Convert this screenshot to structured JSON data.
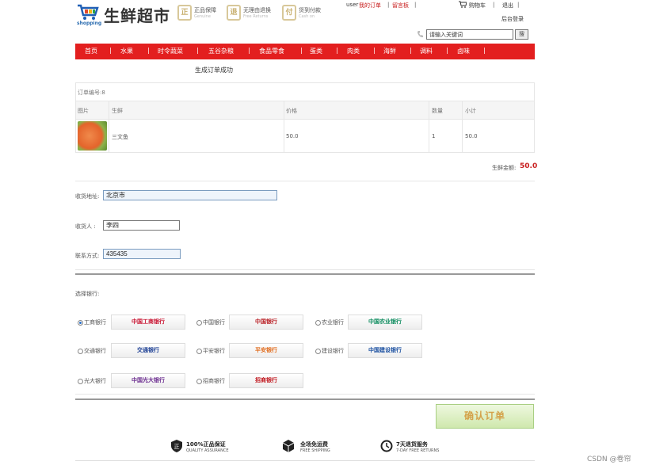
{
  "header": {
    "logo_sub": "shopping",
    "logo_title": "生鲜超市",
    "badges": [
      {
        "icon": "正",
        "title": "正品保障",
        "sub": "Genuine"
      },
      {
        "icon": "退",
        "title": "无理由退换",
        "sub": "Free Returns"
      },
      {
        "icon": "付",
        "title": "货到付款",
        "sub": "Cash on"
      }
    ],
    "user_label": "user",
    "my_orders": "我的订单",
    "message_board": "留言板",
    "cart": "购物车",
    "logout": "退出",
    "admin": "后台登录",
    "search_placeholder": "请输入关键词",
    "search_button": "搜"
  },
  "nav": [
    "首页",
    "水果",
    "时令蔬菜",
    "五谷杂粮",
    "食品零食",
    "蛋类",
    "肉类",
    "海鲜",
    "调料",
    "卤味"
  ],
  "message": "生成订单成功",
  "order": {
    "number_label": "订单编号:8",
    "columns": [
      "图片",
      "生鲜",
      "价格",
      "数量",
      "小计"
    ],
    "rows": [
      {
        "name": "三文鱼",
        "price": "50.0",
        "qty": "1",
        "subtotal": "50.0"
      }
    ],
    "total_label": "生鲜金额:",
    "total_value": "50.0"
  },
  "form": {
    "address_label": "收货地址:",
    "address_value": "北京市",
    "receiver_label": "收货人 :",
    "receiver_value": "李四",
    "phone_label": "联系方式:",
    "phone_value": "435435"
  },
  "bank_section_label": "选择银行:",
  "banks": [
    {
      "label": "工商银行",
      "logo": "中国工商银行",
      "color": "#c8102e",
      "selected": true
    },
    {
      "label": "中国银行",
      "logo": "中国银行",
      "color": "#b81c22",
      "selected": false
    },
    {
      "label": "农业银行",
      "logo": "中国农业银行",
      "color": "#0a8a5c",
      "selected": false
    },
    {
      "label": "交通银行",
      "logo": "交通银行",
      "color": "#1c3f94",
      "selected": false
    },
    {
      "label": "平安银行",
      "logo": "平安银行",
      "color": "#e06a1b",
      "selected": false
    },
    {
      "label": "建设银行",
      "logo": "中国建设银行",
      "color": "#1a4fa0",
      "selected": false
    },
    {
      "label": "光大银行",
      "logo": "中国光大银行",
      "color": "#6b2c8f",
      "selected": false
    },
    {
      "label": "招商银行",
      "logo": "招商银行",
      "color": "#c0161d",
      "selected": false
    }
  ],
  "confirm_button": "确认订单",
  "footer": [
    {
      "icon": "shield-icon",
      "title": "100%正品保证",
      "sub": "QUALITY ASSURANCE"
    },
    {
      "icon": "box-icon",
      "title": "全场免运费",
      "sub": "FREE SHIPPING"
    },
    {
      "icon": "clock-icon",
      "title": "7天退货服务",
      "sub": "7-DAY FREE RETURNS"
    }
  ],
  "watermark": "CSDN @卷帘",
  "colors": {
    "nav_bg": "#e31f1f",
    "accent_red": "#c81e1e",
    "confirm_text": "#d4a24a"
  }
}
